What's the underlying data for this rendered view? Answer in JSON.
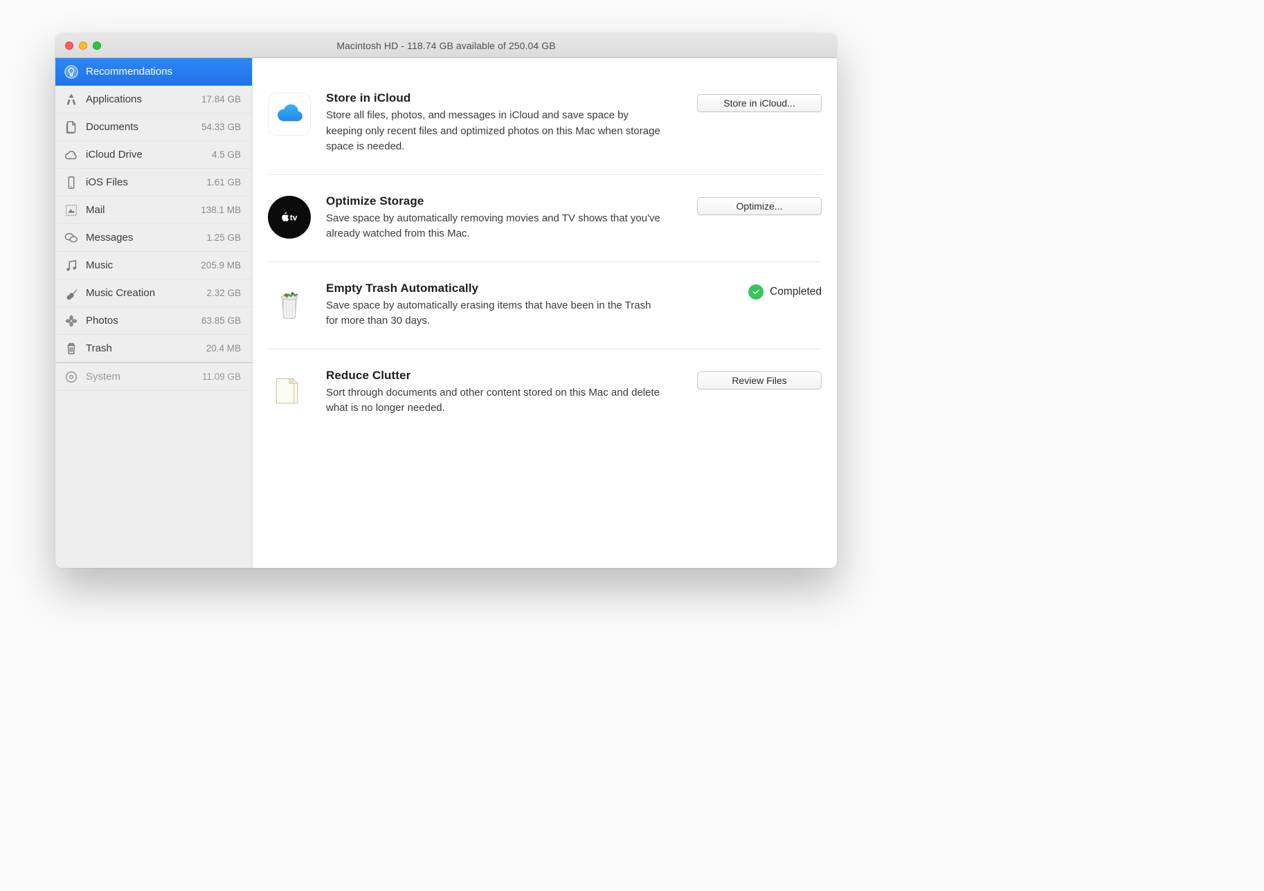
{
  "window": {
    "title": "Macintosh HD - 118.74 GB available of 250.04 GB"
  },
  "sidebar": {
    "items": [
      {
        "label": "Recommendations",
        "size": ""
      },
      {
        "label": "Applications",
        "size": "17.84 GB"
      },
      {
        "label": "Documents",
        "size": "54.33 GB"
      },
      {
        "label": "iCloud Drive",
        "size": "4.5 GB"
      },
      {
        "label": "iOS Files",
        "size": "1.61 GB"
      },
      {
        "label": "Mail",
        "size": "138.1 MB"
      },
      {
        "label": "Messages",
        "size": "1.25 GB"
      },
      {
        "label": "Music",
        "size": "205.9 MB"
      },
      {
        "label": "Music Creation",
        "size": "2.32 GB"
      },
      {
        "label": "Photos",
        "size": "63.85 GB"
      },
      {
        "label": "Trash",
        "size": "20.4 MB"
      },
      {
        "label": "System",
        "size": "11.09 GB"
      }
    ]
  },
  "recommendations": [
    {
      "title": "Store in iCloud",
      "desc": "Store all files, photos, and messages in iCloud and save space by keeping only recent files and optimized photos on this Mac when storage space is needed.",
      "button": "Store in iCloud..."
    },
    {
      "title": "Optimize Storage",
      "desc": "Save space by automatically removing movies and TV shows that you've already watched from this Mac.",
      "button": "Optimize..."
    },
    {
      "title": "Empty Trash Automatically",
      "desc": "Save space by automatically erasing items that have been in the Trash for more than 30 days.",
      "status": "Completed"
    },
    {
      "title": "Reduce Clutter",
      "desc": "Sort through documents and other content stored on this Mac and delete what is no longer needed.",
      "button": "Review Files"
    }
  ]
}
